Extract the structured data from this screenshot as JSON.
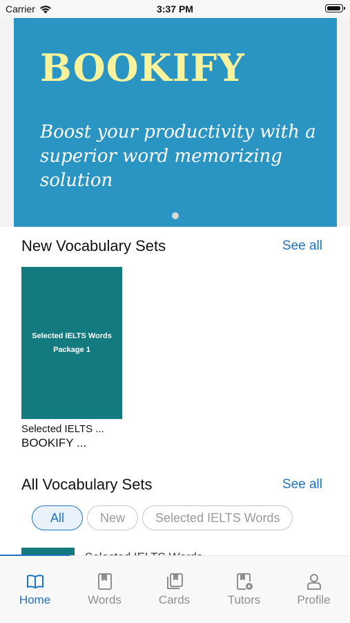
{
  "status_bar": {
    "carrier": "Carrier",
    "time": "3:37 PM"
  },
  "banner": {
    "title": "BOOKIFY",
    "subtitle": "Boost your productivity with a superior word memorizing solution",
    "colors": {
      "background": "#2a94c2",
      "title": "#f6f39c"
    }
  },
  "new_sets": {
    "title": "New Vocabulary Sets",
    "see_all": "See all",
    "items": [
      {
        "cover_line1": "Selected IELTS Words",
        "cover_line2": "Package 1",
        "name": "Selected IELTS ...",
        "author": "BOOKIFY ..."
      }
    ]
  },
  "all_sets": {
    "title": "All Vocabulary Sets",
    "see_all": "See all",
    "filters": [
      {
        "label": "All",
        "selected": true
      },
      {
        "label": "New",
        "selected": false
      },
      {
        "label": "Selected IELTS Words",
        "selected": false
      }
    ],
    "peek_item": "Selected IELTS Words"
  },
  "tabbar": {
    "tabs": [
      {
        "label": "Home",
        "icon": "book-open-icon",
        "active": true
      },
      {
        "label": "Words",
        "icon": "bookmark-book-icon",
        "active": false
      },
      {
        "label": "Cards",
        "icon": "cards-icon",
        "active": false
      },
      {
        "label": "Tutors",
        "icon": "video-book-icon",
        "active": false
      },
      {
        "label": "Profile",
        "icon": "person-icon",
        "active": false
      }
    ]
  },
  "colors": {
    "accent": "#1e73be",
    "teal": "#137b80",
    "inactive": "#8e8e8e"
  }
}
